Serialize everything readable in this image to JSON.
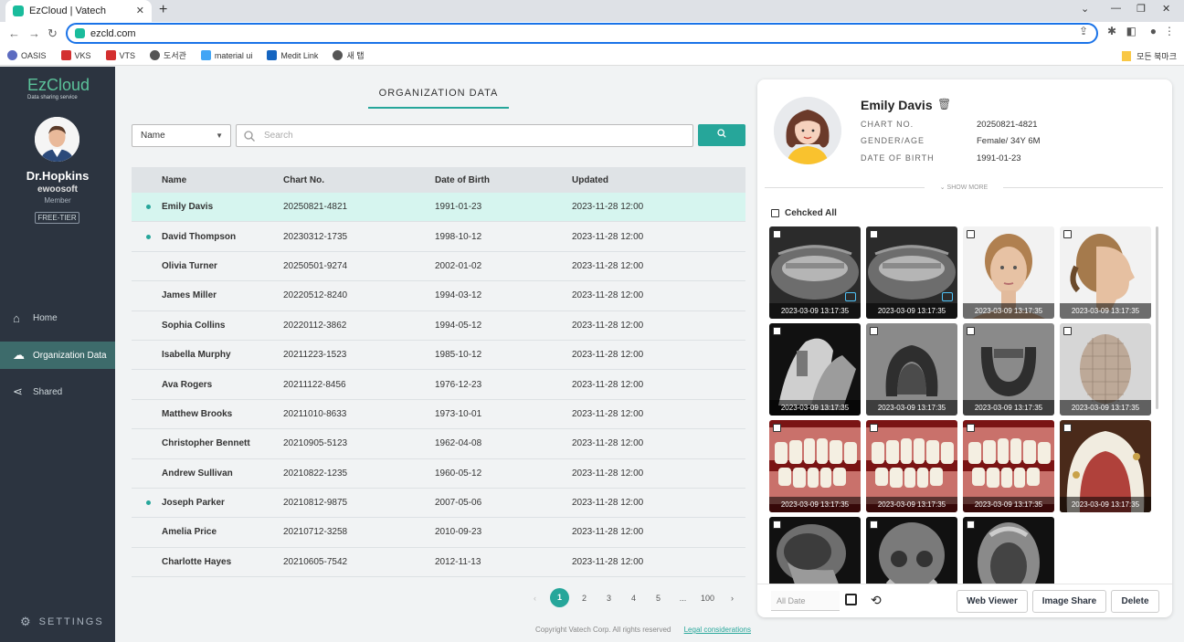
{
  "browser": {
    "tab_title": "EzCloud | Vatech",
    "url": "ezcld.com",
    "bookmarks": [
      "OASIS",
      "VKS",
      "VTS",
      "도서관",
      "material ui",
      "Medit Link",
      "새 탭"
    ],
    "bookmarks_right": "모든 북마크"
  },
  "sidebar": {
    "logo": "EzCloud",
    "logo_sub": "Data sharing service",
    "user_name": "Dr.Hopkins",
    "org": "ewoosoft",
    "role": "Member",
    "tier": "FREE-TIER",
    "nav": [
      {
        "label": "Home",
        "icon": "home-icon"
      },
      {
        "label": "Organization Data",
        "icon": "cloud-upload-icon"
      },
      {
        "label": "Shared",
        "icon": "share-icon"
      }
    ],
    "settings": "SETTINGS"
  },
  "main": {
    "title": "ORGANIZATION DATA",
    "filter_value": "Name",
    "search_placeholder": "Search",
    "columns": [
      "Name",
      "Chart No.",
      "Date of Birth",
      "Updated"
    ],
    "rows": [
      {
        "name": "Emily Davis",
        "chart": "20250821-4821",
        "dob": "1991-01-23",
        "updated": "2023-11-28 12:00",
        "dot": true
      },
      {
        "name": "David Thompson",
        "chart": "20230312-1735",
        "dob": "1998-10-12",
        "updated": "2023-11-28 12:00",
        "dot": true
      },
      {
        "name": "Olivia Turner",
        "chart": "20250501-9274",
        "dob": "2002-01-02",
        "updated": "2023-11-28 12:00",
        "dot": false
      },
      {
        "name": "James Miller",
        "chart": "20220512-8240",
        "dob": "1994-03-12",
        "updated": "2023-11-28 12:00",
        "dot": false
      },
      {
        "name": "Sophia Collins",
        "chart": "20220112-3862",
        "dob": "1994-05-12",
        "updated": "2023-11-28 12:00",
        "dot": false
      },
      {
        "name": "Isabella Murphy",
        "chart": "20211223-1523",
        "dob": "1985-10-12",
        "updated": "2023-11-28 12:00",
        "dot": false
      },
      {
        "name": "Ava Rogers",
        "chart": "20211122-8456",
        "dob": "1976-12-23",
        "updated": "2023-11-28 12:00",
        "dot": false
      },
      {
        "name": "Matthew Brooks",
        "chart": "20211010-8633",
        "dob": "1973-10-01",
        "updated": "2023-11-28 12:00",
        "dot": false
      },
      {
        "name": "Christopher Bennett",
        "chart": "20210905-5123",
        "dob": "1962-04-08",
        "updated": "2023-11-28 12:00",
        "dot": false
      },
      {
        "name": "Andrew Sullivan",
        "chart": "20210822-1235",
        "dob": "1960-05-12",
        "updated": "2023-11-28 12:00",
        "dot": false
      },
      {
        "name": "Joseph Parker",
        "chart": "20210812-9875",
        "dob": "2007-05-06",
        "updated": "2023-11-28 12:00",
        "dot": true
      },
      {
        "name": "Amelia Price",
        "chart": "20210712-3258",
        "dob": "2010-09-23",
        "updated": "2023-11-28 12:00",
        "dot": false
      },
      {
        "name": "Charlotte Hayes",
        "chart": "20210605-7542",
        "dob": "2012-11-13",
        "updated": "2023-11-28 12:00",
        "dot": false
      }
    ],
    "pagination": [
      "1",
      "2",
      "3",
      "4",
      "5",
      "...",
      "100"
    ],
    "current_page": "1",
    "footer_copy": "Copyright Vatech Corp. All rights reserved",
    "footer_link": "Legal considerations"
  },
  "patient": {
    "name": "Emily Davis",
    "chart_label": "CHART NO.",
    "chart_value": "20250821-4821",
    "gender_label": "GENDER/AGE",
    "gender_value": "Female/ 34Y 6M",
    "dob_label": "DATE OF BIRTH",
    "dob_value": "1991-01-23",
    "show_more": "SHOW MORE",
    "check_all": "Cehcked All",
    "images": [
      {
        "kind": "panoramic-xray",
        "timestamp": "2023-03-09 13:17:35",
        "comment": true
      },
      {
        "kind": "panoramic-xray",
        "timestamp": "2023-03-09 13:17:35",
        "comment": true
      },
      {
        "kind": "face-front-photo",
        "timestamp": "2023-03-09 13:17:35",
        "comment": false
      },
      {
        "kind": "face-side-photo",
        "timestamp": "2023-03-09 13:17:35",
        "comment": false
      },
      {
        "kind": "intraoral-xray",
        "timestamp": "2023-03-09 13:17:35",
        "comment": false
      },
      {
        "kind": "upper-arch-model",
        "timestamp": "2023-03-09 13:17:35",
        "comment": false
      },
      {
        "kind": "lower-arch-model",
        "timestamp": "2023-03-09 13:17:35",
        "comment": false
      },
      {
        "kind": "face-3d-mesh",
        "timestamp": "2023-03-09 13:17:35",
        "comment": false
      },
      {
        "kind": "intraoral-photo",
        "timestamp": "2023-03-09 13:17:35",
        "comment": false
      },
      {
        "kind": "intraoral-photo",
        "timestamp": "2023-03-09 13:17:35",
        "comment": false
      },
      {
        "kind": "intraoral-photo",
        "timestamp": "2023-03-09 13:17:35",
        "comment": false
      },
      {
        "kind": "occlusal-photo",
        "timestamp": "2023-03-09 13:17:35",
        "comment": false
      },
      {
        "kind": "lateral-ceph-xray",
        "timestamp": "",
        "comment": false
      },
      {
        "kind": "pa-ceph-xray",
        "timestamp": "",
        "comment": false
      },
      {
        "kind": "smv-xray",
        "timestamp": "",
        "comment": false
      }
    ],
    "date_placeholder": "All Date",
    "buttons": {
      "web_viewer": "Web Viewer",
      "image_share": "Image Share",
      "delete": "Delete"
    }
  },
  "colors": {
    "accent": "#26a69a",
    "sidebar": "#2c3440",
    "selected_row": "#d6f5ef"
  }
}
